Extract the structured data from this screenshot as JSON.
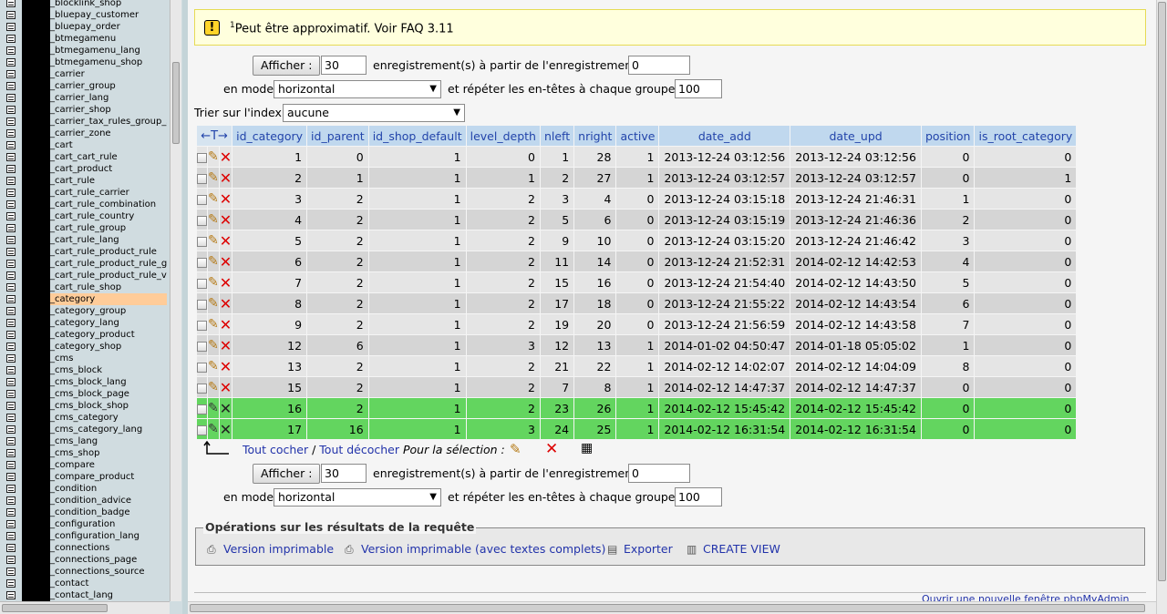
{
  "sidebar": {
    "active_index": 25,
    "tables": [
      "_blocklink_shop",
      "_bluepay_customer",
      "_bluepay_order",
      "_btmegamenu",
      "_btmegamenu_lang",
      "_btmegamenu_shop",
      "_carrier",
      "_carrier_group",
      "_carrier_lang",
      "_carrier_shop",
      "_carrier_tax_rules_group_shop",
      "_carrier_zone",
      "_cart",
      "_cart_cart_rule",
      "_cart_product",
      "_cart_rule",
      "_cart_rule_carrier",
      "_cart_rule_combination",
      "_cart_rule_country",
      "_cart_rule_group",
      "_cart_rule_lang",
      "_cart_rule_product_rule",
      "_cart_rule_product_rule_group",
      "_cart_rule_product_rule_value",
      "_cart_rule_shop",
      "_category",
      "_category_group",
      "_category_lang",
      "_category_product",
      "_category_shop",
      "_cms",
      "_cms_block",
      "_cms_block_lang",
      "_cms_block_page",
      "_cms_block_shop",
      "_cms_category",
      "_cms_category_lang",
      "_cms_lang",
      "_cms_shop",
      "_compare",
      "_compare_product",
      "_condition",
      "_condition_advice",
      "_condition_badge",
      "_configuration",
      "_configuration_lang",
      "_connections",
      "_connections_page",
      "_connections_source",
      "_contact",
      "_contact_lang"
    ]
  },
  "notice": {
    "icon": "warning-icon",
    "sup": "1",
    "text": "Peut être approximatif. Voir FAQ 3.11"
  },
  "navform": {
    "show_label": "Afficher :",
    "rows_value": "30",
    "records_from_label": "enregistrement(s) à partir de l'enregistrement n°",
    "start_value": "0",
    "mode_label": "en mode",
    "mode_value": "horizontal",
    "repeat_label": "et répéter les en-têtes à chaque groupe de",
    "repeat_value": "100",
    "sort_label": "Trier sur l'index:",
    "sort_value": "aucune"
  },
  "table": {
    "control_header": "←T→",
    "columns": [
      "id_category",
      "id_parent",
      "id_shop_default",
      "level_depth",
      "nleft",
      "nright",
      "active",
      "date_add",
      "date_upd",
      "position",
      "is_root_category"
    ],
    "rows": [
      {
        "cells": [
          "1",
          "0",
          "1",
          "0",
          "1",
          "28",
          "1",
          "2013-12-24 03:12:56",
          "2013-12-24 03:12:56",
          "0",
          "0"
        ],
        "marked": false
      },
      {
        "cells": [
          "2",
          "1",
          "1",
          "1",
          "2",
          "27",
          "1",
          "2013-12-24 03:12:57",
          "2013-12-24 03:12:57",
          "0",
          "1"
        ],
        "marked": false
      },
      {
        "cells": [
          "3",
          "2",
          "1",
          "2",
          "3",
          "4",
          "0",
          "2013-12-24 03:15:18",
          "2013-12-24 21:46:31",
          "1",
          "0"
        ],
        "marked": false
      },
      {
        "cells": [
          "4",
          "2",
          "1",
          "2",
          "5",
          "6",
          "0",
          "2013-12-24 03:15:19",
          "2013-12-24 21:46:36",
          "2",
          "0"
        ],
        "marked": false
      },
      {
        "cells": [
          "5",
          "2",
          "1",
          "2",
          "9",
          "10",
          "0",
          "2013-12-24 03:15:20",
          "2013-12-24 21:46:42",
          "3",
          "0"
        ],
        "marked": false
      },
      {
        "cells": [
          "6",
          "2",
          "1",
          "2",
          "11",
          "14",
          "0",
          "2013-12-24 21:52:31",
          "2014-02-12 14:42:53",
          "4",
          "0"
        ],
        "marked": false
      },
      {
        "cells": [
          "7",
          "2",
          "1",
          "2",
          "15",
          "16",
          "0",
          "2013-12-24 21:54:40",
          "2014-02-12 14:43:50",
          "5",
          "0"
        ],
        "marked": false
      },
      {
        "cells": [
          "8",
          "2",
          "1",
          "2",
          "17",
          "18",
          "0",
          "2013-12-24 21:55:22",
          "2014-02-12 14:43:54",
          "6",
          "0"
        ],
        "marked": false
      },
      {
        "cells": [
          "9",
          "2",
          "1",
          "2",
          "19",
          "20",
          "0",
          "2013-12-24 21:56:59",
          "2014-02-12 14:43:58",
          "7",
          "0"
        ],
        "marked": false
      },
      {
        "cells": [
          "12",
          "6",
          "1",
          "3",
          "12",
          "13",
          "1",
          "2014-01-02 04:50:47",
          "2014-01-18 05:05:02",
          "1",
          "0"
        ],
        "marked": false
      },
      {
        "cells": [
          "13",
          "2",
          "1",
          "2",
          "21",
          "22",
          "1",
          "2014-02-12 14:02:07",
          "2014-02-12 14:04:09",
          "8",
          "0"
        ],
        "marked": false
      },
      {
        "cells": [
          "15",
          "2",
          "1",
          "2",
          "7",
          "8",
          "1",
          "2014-02-12 14:47:37",
          "2014-02-12 14:47:37",
          "0",
          "0"
        ],
        "marked": false
      },
      {
        "cells": [
          "16",
          "2",
          "1",
          "2",
          "23",
          "26",
          "1",
          "2014-02-12 15:45:42",
          "2014-02-12 15:45:42",
          "0",
          "0"
        ],
        "marked": true
      },
      {
        "cells": [
          "17",
          "16",
          "1",
          "3",
          "24",
          "25",
          "1",
          "2014-02-12 16:31:54",
          "2014-02-12 16:31:54",
          "0",
          "0"
        ],
        "marked": true
      }
    ]
  },
  "bulk": {
    "check_all": "Tout cocher",
    "separator": " / ",
    "uncheck_all": "Tout décocher",
    "for_selection": "Pour la sélection :"
  },
  "operations": {
    "legend": "Opérations sur les résultats de la requête",
    "links": [
      {
        "label": "Version imprimable",
        "icon": "print-icon"
      },
      {
        "label": "Version imprimable (avec textes complets)",
        "icon": "print-icon"
      },
      {
        "label": "Exporter",
        "icon": "export-icon"
      },
      {
        "label": "CREATE VIEW",
        "icon": "view-icon"
      }
    ]
  },
  "footer": {
    "new_window": "Ouvrir une nouvelle fenêtre phpMyAdmin"
  }
}
